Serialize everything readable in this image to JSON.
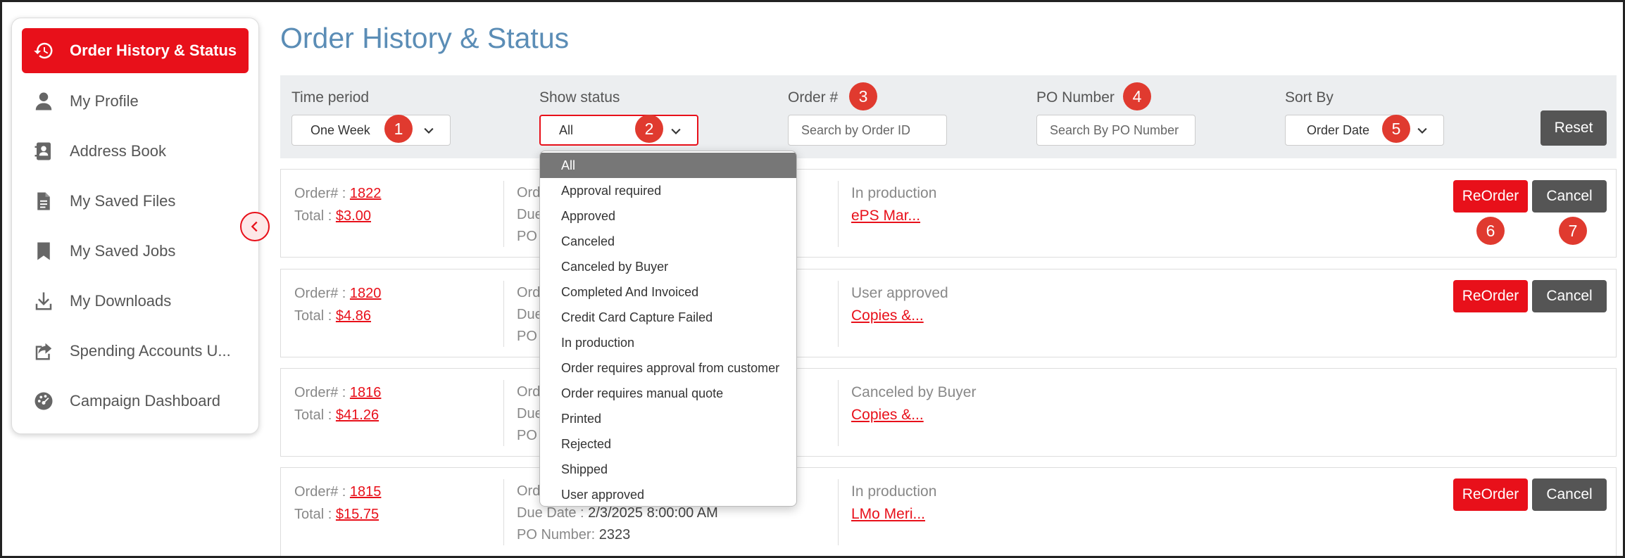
{
  "sidebar": {
    "items": [
      {
        "label": "Order History & Status",
        "icon": "history-icon"
      },
      {
        "label": "My Profile",
        "icon": "user-icon"
      },
      {
        "label": "Address Book",
        "icon": "address-book-icon"
      },
      {
        "label": "My Saved Files",
        "icon": "file-icon"
      },
      {
        "label": "My Saved Jobs",
        "icon": "bookmark-icon"
      },
      {
        "label": "My Downloads",
        "icon": "download-icon"
      },
      {
        "label": "Spending Accounts U...",
        "icon": "share-icon"
      },
      {
        "label": "Campaign Dashboard",
        "icon": "dashboard-icon"
      }
    ]
  },
  "page": {
    "title": "Order History & Status"
  },
  "filters": {
    "time_period": {
      "label": "Time period",
      "value": "One Week",
      "badge": "1"
    },
    "show_status": {
      "label": "Show status",
      "value": "All",
      "badge": "2"
    },
    "order_num": {
      "label": "Order #",
      "placeholder": "Search by Order ID",
      "badge": "3"
    },
    "po_number": {
      "label": "PO Number",
      "placeholder": "Search By PO Number",
      "badge": "4"
    },
    "sort_by": {
      "label": "Sort By",
      "value": "Order Date",
      "badge": "5"
    },
    "reset_label": "Reset"
  },
  "status_options": [
    "All",
    "Approval required",
    "Approved",
    "Canceled",
    "Canceled by Buyer",
    "Completed And Invoiced",
    "Credit Card Capture Failed",
    "In production",
    "Order requires approval from customer",
    "Order requires manual quote",
    "Printed",
    "Rejected",
    "Shipped",
    "User approved"
  ],
  "labels": {
    "order": "Order# :",
    "total": "Total :",
    "ord_trunc": "Ord",
    "due_trunc": "Due",
    "po_trunc": "PO",
    "due_date": "Due Date :",
    "po_number": "PO Number:",
    "reorder": "ReOrder",
    "cancel": "Cancel",
    "badge6": "6",
    "badge7": "7"
  },
  "orders": [
    {
      "number": "1822",
      "total": "$3.00",
      "status": "In production",
      "product": "ePS Mar..."
    },
    {
      "number": "1820",
      "total": "$4.86",
      "status": "User approved",
      "product": "Copies &..."
    },
    {
      "number": "1816",
      "total": "$41.26",
      "status": "Canceled by Buyer",
      "product": "Copies &..."
    },
    {
      "number": "1815",
      "total": "$15.75",
      "status": "In production",
      "product": "LMo Meri...",
      "due_date": "2/3/2025 8:00:00 AM",
      "po_number": "2323"
    }
  ],
  "colors": {
    "accent": "#e8101a",
    "title": "#5b8db6",
    "dark_button": "#555555",
    "filter_bg": "#eceef0"
  }
}
